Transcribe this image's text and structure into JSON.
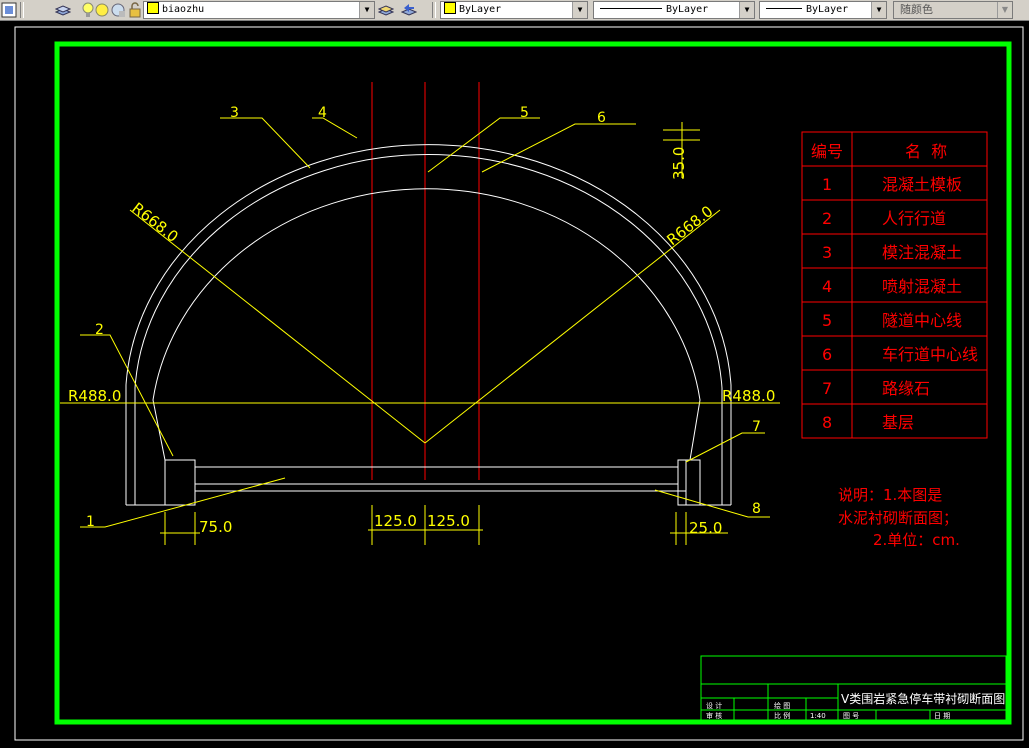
{
  "toolbar": {
    "layer_name": "biaozhu",
    "color_label": "ByLayer",
    "linetype_label": "ByLayer",
    "lineweight_label": "ByLayer",
    "plotstyle_label": "随颜色",
    "accent_yellow": "#ffff00"
  },
  "drawing": {
    "callouts": [
      "1",
      "2",
      "3",
      "4",
      "5",
      "6",
      "7",
      "8"
    ],
    "dims": {
      "r668_left": "R668.0",
      "r668_right": "R668.0",
      "r488_left": "R488.0",
      "r488_right": "R488.0",
      "d35": "35.0",
      "d75": "75.0",
      "d125_left": "125.0",
      "d125_right": "125.0",
      "d25": "25.0"
    },
    "legend": {
      "header_no": "编号",
      "header_name": "名  称",
      "rows": [
        {
          "no": "1",
          "name": "混凝土模板"
        },
        {
          "no": "2",
          "name": "人行行道"
        },
        {
          "no": "3",
          "name": "模注混凝土"
        },
        {
          "no": "4",
          "name": "喷射混凝土"
        },
        {
          "no": "5",
          "name": "隧道中心线"
        },
        {
          "no": "6",
          "name": "车行道中心线"
        },
        {
          "no": "7",
          "name": "路缘石"
        },
        {
          "no": "8",
          "name": "基层"
        }
      ]
    },
    "notes": {
      "line1": "说明：1.本图是",
      "line2": "水泥衬砌断面图；",
      "line3": "2.单位：cm."
    },
    "title_block": {
      "title": "V类围岩紧急停车带衬砌断面图",
      "design": "设 计",
      "drawn": "绘 图",
      "review": "审 核",
      "scale_label": "比 例",
      "scale_value": "1:40",
      "drawing_no": "图 号",
      "date": "日 期"
    },
    "colors": {
      "frame": "#00ff00",
      "lines": "#ffffff",
      "dims": "#ffff00",
      "center": "#ff0000",
      "legend": "#ff0000"
    }
  }
}
